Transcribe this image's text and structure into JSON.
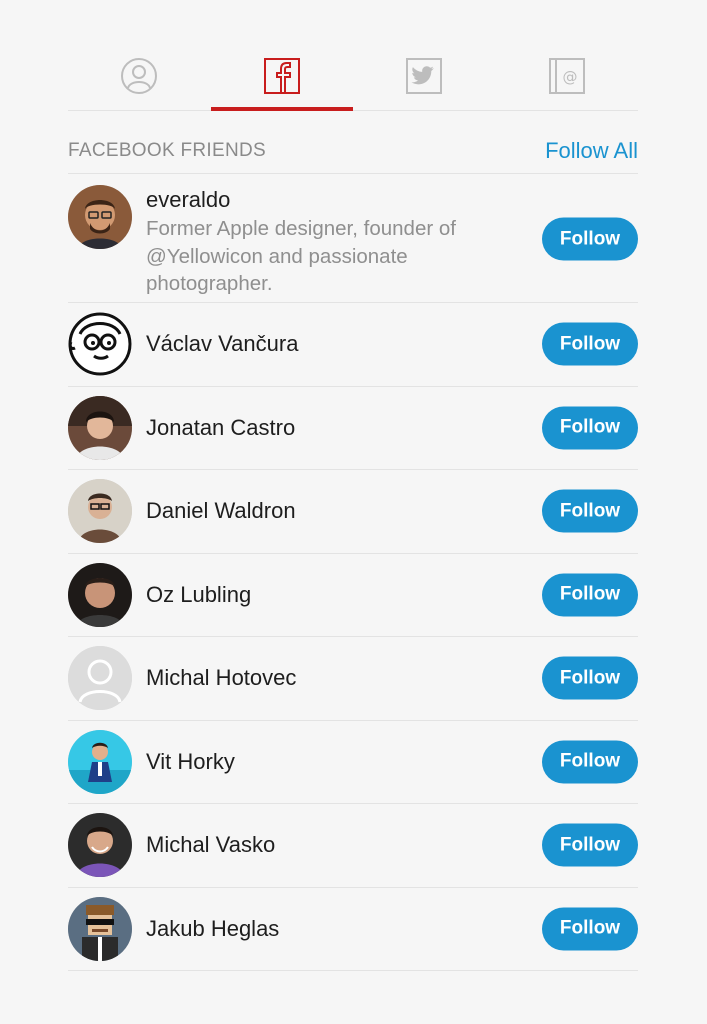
{
  "tabs": [
    {
      "icon": "person-icon",
      "active": false
    },
    {
      "icon": "facebook-icon",
      "active": true
    },
    {
      "icon": "twitter-icon",
      "active": false
    },
    {
      "icon": "email-icon",
      "active": false
    }
  ],
  "accent_color": "#c81d1d",
  "button_color": "#1a93d0",
  "section": {
    "title": "FACEBOOK FRIENDS",
    "follow_all_label": "Follow All"
  },
  "friends": [
    {
      "name": "everaldo",
      "bio": "Former Apple designer, founder of @Yellowicon and passionate photographer.",
      "follow_label": "Follow"
    },
    {
      "name": "Václav Vančura",
      "follow_label": "Follow"
    },
    {
      "name": "Jonatan Castro",
      "follow_label": "Follow"
    },
    {
      "name": "Daniel Waldron",
      "follow_label": "Follow"
    },
    {
      "name": "Oz Lubling",
      "follow_label": "Follow"
    },
    {
      "name": "Michal Hotovec",
      "follow_label": "Follow"
    },
    {
      "name": "Vit Horky",
      "follow_label": "Follow"
    },
    {
      "name": "Michal Vasko",
      "follow_label": "Follow"
    },
    {
      "name": "Jakub Heglas",
      "follow_label": "Follow"
    }
  ]
}
